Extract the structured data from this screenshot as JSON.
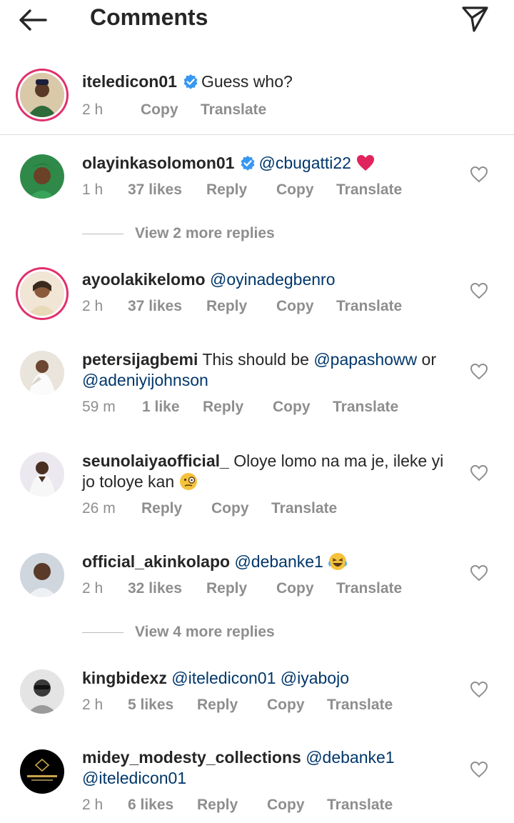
{
  "header": {
    "title": "Comments"
  },
  "caption": {
    "username": "iteledicon01",
    "text": "Guess who?",
    "time": "2 h",
    "copy": "Copy",
    "translate": "Translate"
  },
  "comments": [
    {
      "username": "olayinkasolomon01",
      "text": "@cbugatti22",
      "time": "1 h",
      "likes": "37 likes",
      "reply": "Reply",
      "copy": "Copy",
      "translate": "Translate"
    },
    {
      "username": "ayoolakikelomo",
      "text": "@oyinadegbenro",
      "time": "2 h",
      "likes": "37 likes",
      "reply": "Reply",
      "copy": "Copy",
      "translate": "Translate"
    },
    {
      "username": "petersijagbemi",
      "text_prefix": "This should be",
      "mention1": "@papashoww",
      "joiner": "or",
      "mention2": "@adeniyijohnson",
      "time": "59 m",
      "likes": "1 like",
      "reply": "Reply",
      "copy": "Copy",
      "translate": "Translate"
    },
    {
      "username": "seunolaiyaofficial_",
      "text1": "Oloye lomo na ma je, ileke yi",
      "text2": "jo toloye kan",
      "time": "26 m",
      "reply": "Reply",
      "copy": "Copy",
      "translate": "Translate"
    },
    {
      "username": "official_akinkolapo",
      "text": "@debanke1",
      "time": "2 h",
      "likes": "32 likes",
      "reply": "Reply",
      "copy": "Copy",
      "translate": "Translate"
    },
    {
      "username": "kingbidexz",
      "mention1": "@iteledicon01",
      "mention2": "@iyabojo",
      "time": "2 h",
      "likes": "5 likes",
      "reply": "Reply",
      "copy": "Copy",
      "translate": "Translate"
    },
    {
      "username": "midey_modesty_collections",
      "mention1": "@debanke1",
      "mention2": "@iteledicon01",
      "time": "2 h",
      "likes": "6 likes",
      "reply": "Reply",
      "copy": "Copy",
      "translate": "Translate"
    }
  ],
  "view_more": [
    "View 2 more replies",
    "View 4 more replies"
  ],
  "colors": {
    "mention": "#00376b",
    "verified": "#3897f0",
    "meta": "#8e8e8e",
    "heart_emoji": "#e0245e"
  },
  "icons": [
    "back-arrow-icon",
    "send-icon",
    "verified-badge-icon",
    "heart-outline-icon",
    "red-heart-emoji",
    "laughing-emoji",
    "monocle-emoji"
  ]
}
